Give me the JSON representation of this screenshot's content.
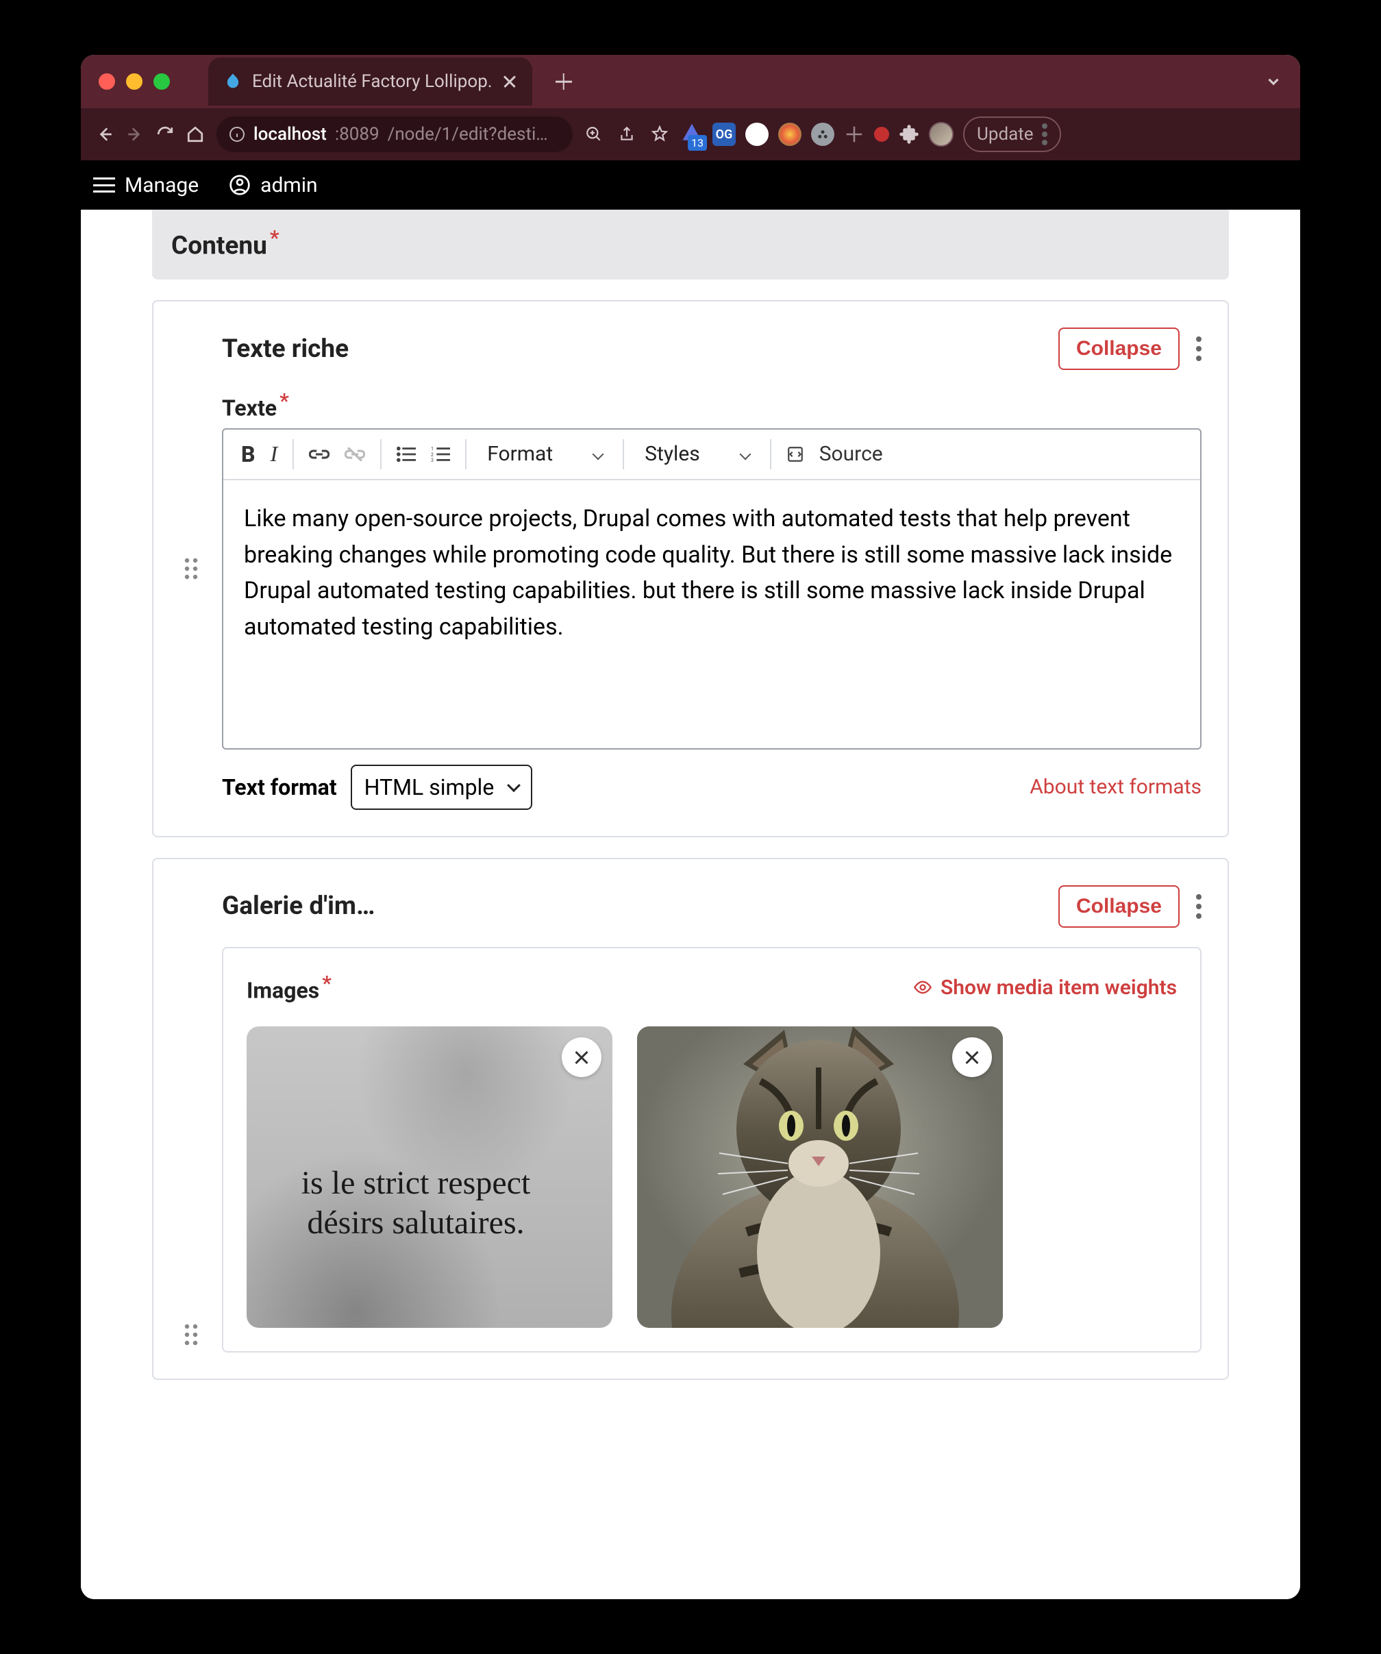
{
  "browser": {
    "tab_title": "Edit Actualité Factory Lollipop.",
    "address_host": "localhost",
    "address_port": ":8089",
    "address_path": "/node/1/edit?desti…",
    "update_label": "Update",
    "blue_badge": "13",
    "og_badge": "OG"
  },
  "admin": {
    "manage": "Manage",
    "user": "admin"
  },
  "content": {
    "header": "Contenu",
    "text_block": {
      "title": "Texte riche",
      "collapse": "Collapse",
      "text_label": "Texte",
      "format_label": "Format",
      "styles_label": "Styles",
      "source_label": "Source",
      "body": "Like many open-source projects, Drupal comes with automated tests that help prevent breaking changes while promoting code quality. But there is still some massive lack inside Drupal automated testing capabilities. but there is still some massive lack inside Drupal automated testing capabilities.",
      "text_format_label": "Text format",
      "text_format_value": "HTML simple",
      "about_link": "About text formats"
    },
    "gallery": {
      "title": "Galerie d'im…",
      "collapse": "Collapse",
      "images_label": "Images",
      "show_weights": "Show media item weights",
      "thumb1_line1": "is le strict respect",
      "thumb1_line2": "désirs salutaires."
    }
  }
}
